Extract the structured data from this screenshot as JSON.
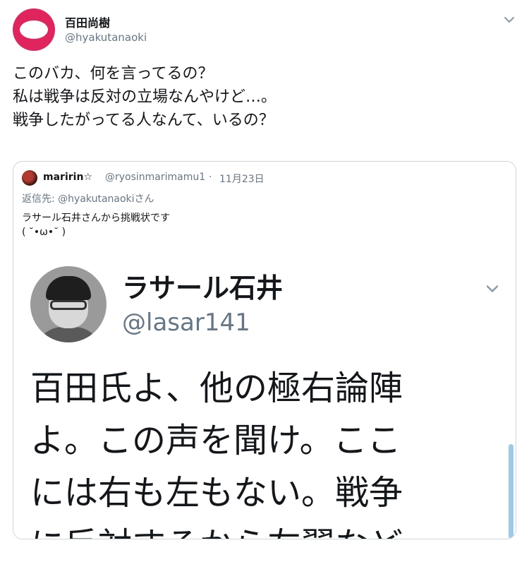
{
  "tweet": {
    "author": {
      "name": "百田尚樹",
      "handle": "@hyakutanaoki",
      "avatar_icon": "avatar-pink-ring"
    },
    "text_lines": [
      "このバカ、何を言ってるの？",
      "私は戦争は反対の立場なんやけど…。",
      "戦争したがってる人なんて、いるの？"
    ],
    "menu_icon": "chevron-down-icon"
  },
  "quote": {
    "author": {
      "name": "maririn☆",
      "handle": "@ryosinmarimamu1",
      "separator": "·",
      "date": "11月23日"
    },
    "reply_to": {
      "prefix": "返信先: ",
      "mention": "@hyakutanaoki",
      "suffix": "さん"
    },
    "text_lines": [
      "ラサール石井さんから挑戦状です",
      "( ˘•ω•˘ )"
    ],
    "embedded_image": {
      "name": "ラサール石井",
      "handle": "@lasar141",
      "body_lines": [
        "百田氏よ、他の極右論陣",
        "よ。この声を聞け。ここ",
        "には右も左もない。戦争",
        "に反対するから左翼など"
      ]
    }
  }
}
